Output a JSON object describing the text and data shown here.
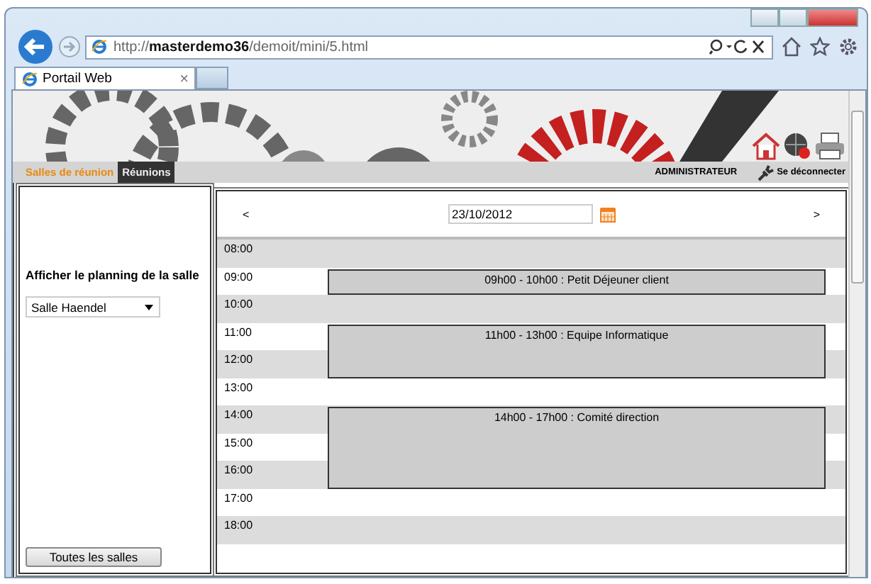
{
  "browser": {
    "address": "http://**masterdemo36**/demoit/mini/5.html",
    "tabs": [
      {
        "label": "Portail Web",
        "selected": true,
        "close": "×"
      }
    ]
  },
  "site": {
    "nav_tabs": [
      {
        "label": "Salles de réunion",
        "selected": false
      },
      {
        "label": "Réunions",
        "selected": true
      }
    ],
    "user": "ADMINISTRATEUR",
    "logout": "Se déconnecter"
  },
  "sidebar": {
    "heading": "Afficher le planning de la salle",
    "room_select": {
      "value": "Salle Haendel"
    },
    "button": "Toutes les salles"
  },
  "calendar": {
    "prev": "<",
    "next": ">",
    "date": "23/10/2012",
    "hours": [
      {
        "label": "08:00",
        "booked": false
      },
      {
        "label": "09:00",
        "booked": true,
        "event": "09h00 - 10h00 : Petit Déjeuner client"
      },
      {
        "label": "10:00",
        "booked": false
      },
      {
        "label": "11:00",
        "booked": true,
        "event": "11h00 - 13h00 : Equipe Informatique"
      },
      {
        "label": "12:00",
        "booked": true
      },
      {
        "label": "13:00",
        "booked": false
      },
      {
        "label": "14:00",
        "booked": true,
        "event": "14h00 - 17h00 : Comité direction"
      },
      {
        "label": "15:00",
        "booked": true
      },
      {
        "label": "16:00",
        "booked": true
      },
      {
        "label": "17:00",
        "booked": false
      },
      {
        "label": "18:00",
        "booked": false
      }
    ]
  }
}
